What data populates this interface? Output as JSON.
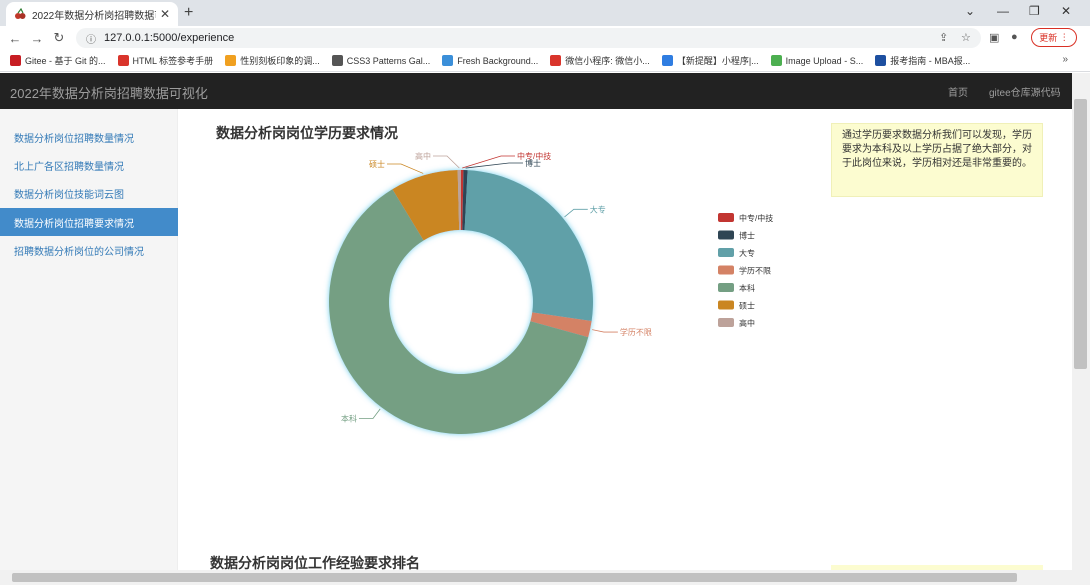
{
  "browser": {
    "tab_title": "2022年数据分析岗招聘数据可视",
    "url": "127.0.0.1:5000/experience",
    "update_label": "更新",
    "bookmarks": [
      {
        "label": "Gitee - 基于 Git 的...",
        "color": "#c71d23"
      },
      {
        "label": "HTML 标签参考手册",
        "color": "#d9342b"
      },
      {
        "label": "性别刻板印象的调...",
        "color": "#f0a020"
      },
      {
        "label": "CSS3 Patterns Gal...",
        "color": "#555555"
      },
      {
        "label": "Fresh Background...",
        "color": "#3b8fd9"
      },
      {
        "label": "微信小程序: 微信小...",
        "color": "#d9342b"
      },
      {
        "label": "【新提醒】小程序|...",
        "color": "#2f7de1"
      },
      {
        "label": "Image Upload - S...",
        "color": "#4caf50"
      },
      {
        "label": "报考指南 - MBA报...",
        "color": "#1d4fa0"
      }
    ]
  },
  "navbar": {
    "brand": "2022年数据分析岗招聘数据可视化",
    "home": "首页",
    "repo": "gitee仓库源代码"
  },
  "sidebar": {
    "items": [
      {
        "label": "数据分析岗位招聘数量情况"
      },
      {
        "label": "北上广各区招聘数量情况"
      },
      {
        "label": "数据分析岗位技能词云图"
      },
      {
        "label": "数据分析岗位招聘要求情况"
      },
      {
        "label": "招聘数据分析岗位的公司情况"
      }
    ]
  },
  "section1": {
    "title": "数据分析岗岗位学历要求情况",
    "note": "通过学历要求数据分析我们可以发现，学历要求为本科及以上学历占据了绝大部分，对于此岗位来说，学历相对还是非常重要的。"
  },
  "section2": {
    "title": "数据分析岗岗位工作经验要求排名"
  },
  "chart_data": {
    "type": "pie",
    "title": "数据分析岗岗位学历要求情况",
    "legend_position": "right",
    "categories": [
      "中专/中技",
      "博士",
      "大专",
      "学历不限",
      "本科",
      "硕士",
      "高中"
    ],
    "values": [
      0.3,
      0.5,
      26.5,
      2.0,
      62.0,
      8.3,
      0.4
    ],
    "colors": [
      "#c23531",
      "#2f4554",
      "#61a0a8",
      "#d48265",
      "#749f83",
      "#ca8622",
      "#bda29a"
    ]
  }
}
